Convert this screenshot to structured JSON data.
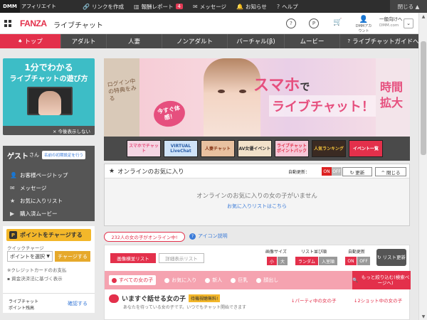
{
  "topbar": {
    "brand": "DMM",
    "affiliate": "アフィリエイト",
    "links": [
      {
        "icon": "link-icon",
        "glyph": "🔗",
        "label": "リンクを作成"
      },
      {
        "icon": "chart-icon",
        "glyph": "▥",
        "label": "報酬レポート",
        "badge": "4"
      },
      {
        "icon": "mail-icon",
        "glyph": "✉",
        "label": "メッセージ"
      },
      {
        "icon": "bell-icon",
        "glyph": "🔔",
        "label": "お知らせ"
      },
      {
        "icon": "help-icon",
        "glyph": "?",
        "label": "ヘルプ"
      }
    ],
    "close": "閉じる ▲"
  },
  "header": {
    "logo": "FANZA",
    "service": "ライブチャット",
    "account_label": "DMMアカウント",
    "user_name": "一般向けへ",
    "user_sub": "DMM.com"
  },
  "nav": {
    "items": [
      "トップ",
      "アダルト",
      "人妻",
      "ノンアダルト",
      "バーチャル(β)",
      "ムービー",
      "ライブチャットガイドへ"
    ]
  },
  "sidebar": {
    "promo_title": "1分でわかる",
    "promo_sub": "ライブチャットの遊び方",
    "promo_hide": "× 今後表示しない",
    "guest": "ゲスト",
    "guest_suffix": "さん",
    "register": "名前の初期設定を行う",
    "menu": [
      {
        "icon": "person-icon",
        "glyph": "👤",
        "label": "お客様ページトップ"
      },
      {
        "icon": "mail-icon",
        "glyph": "✉",
        "label": "メッセージ"
      },
      {
        "icon": "star-icon",
        "glyph": "★",
        "label": "お気に入りリスト"
      },
      {
        "icon": "video-icon",
        "glyph": "▶",
        "label": "購入済ムービー"
      }
    ],
    "charge_button": "ポイントをチャージする",
    "quick_label": "クイックチャージ",
    "select_value": "ポイントを選択",
    "charge_small": "チャージする",
    "note1": "※クレジットカードのお支払",
    "note2": "資金決済法に基づく表示",
    "mini_l1": "ライブチャット",
    "mini_l2": "ポイント残高",
    "mini_confirm": "確認する"
  },
  "banner": {
    "left_text": "ログイン中の特典をみる",
    "bubble": "今すぐ体感！",
    "title": "スマホ",
    "title_de": "で",
    "subtitle": "ライブチャット！",
    "right_text": "時間拡大"
  },
  "thumbs": [
    {
      "label": "スマホでチャット",
      "bg": "#f4d6e3",
      "color": "#e64f7e"
    },
    {
      "label": "VIRTUAL LiveChat",
      "bg": "#cfe3f8",
      "color": "#2b5fa8"
    },
    {
      "label": "人妻チャット",
      "bg": "#e8c1a0",
      "color": "#8a3a1a"
    },
    {
      "label": "AV女優イベント",
      "bg": "#f1e1c9",
      "color": "#333"
    },
    {
      "label": "ライブチャットポイントパック",
      "bg": "#f6c8d8",
      "color": "#e3304b"
    },
    {
      "label": "人気ランキング",
      "bg": "#3a2a22",
      "color": "#f3c23a"
    },
    {
      "label": "イベント一覧",
      "bg": "#e3304b",
      "color": "#fff"
    }
  ],
  "favorites": {
    "title": "オンラインのお気に入り",
    "auto": "自動更新：",
    "on": "ON",
    "off": "OFF",
    "update": "↻ 更新",
    "close": "^ 閉じる",
    "empty": "オンラインのお気に入りの女の子がいません",
    "link": "お気に入りリストはこちら"
  },
  "online_count": "232人の女の子がオンライン中!",
  "icon_help": "アイコン説明",
  "panel": {
    "view1": "画像横並リスト",
    "view2": "詳細表示リスト",
    "size_label": "画像サイズ",
    "size_small": "小",
    "size_large": "大",
    "order_label": "リスト並び順",
    "order_random": "ランダム",
    "order_new": "入室順",
    "auto_label": "自動更新",
    "on": "ON",
    "off": "OFF",
    "refresh": "リスト更新",
    "filters": [
      "すべての女の子",
      "お気に入り",
      "新人",
      "巨乳",
      "顔出し"
    ],
    "more": "もっと絞り込む(検索ページへ)",
    "talk_title": "いますぐ話せる女の子",
    "talk_tag": "待機視聴無料!",
    "talk_sub": "あなたを待っている女の子です。いつでもチャット開始できます",
    "party": "↓パーティ中の女の子",
    "twoshot": "↓2ショット中の女の子"
  }
}
